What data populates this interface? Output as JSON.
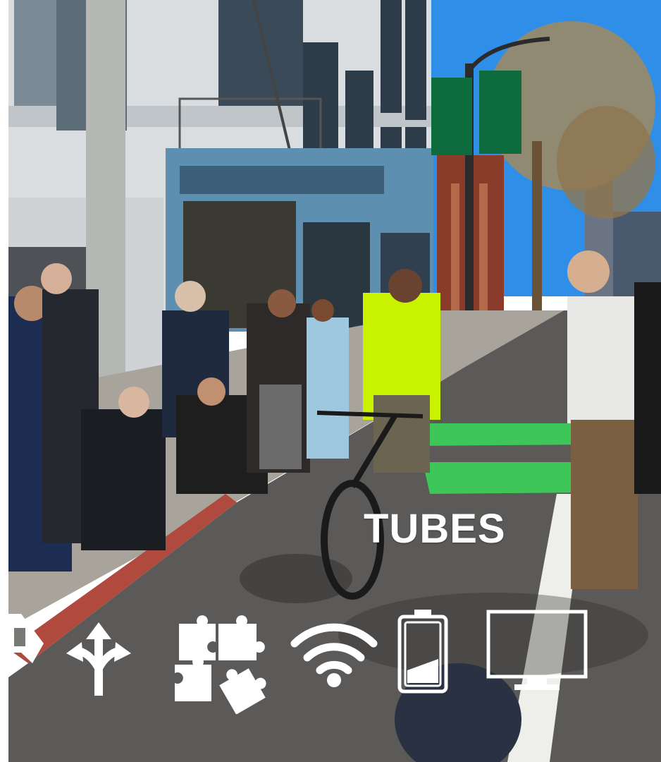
{
  "caption": {
    "text": "TUBES"
  },
  "icons": [
    "arrow-icon",
    "split-arrows-icon",
    "puzzle-pieces-icon",
    "wifi-icon",
    "battery-low-icon",
    "monitor-icon"
  ],
  "colors": {
    "icon": "#ffffff",
    "sky": "#2f8fe8",
    "bike_lane": "#3ec659",
    "vest": "#c8f200"
  }
}
